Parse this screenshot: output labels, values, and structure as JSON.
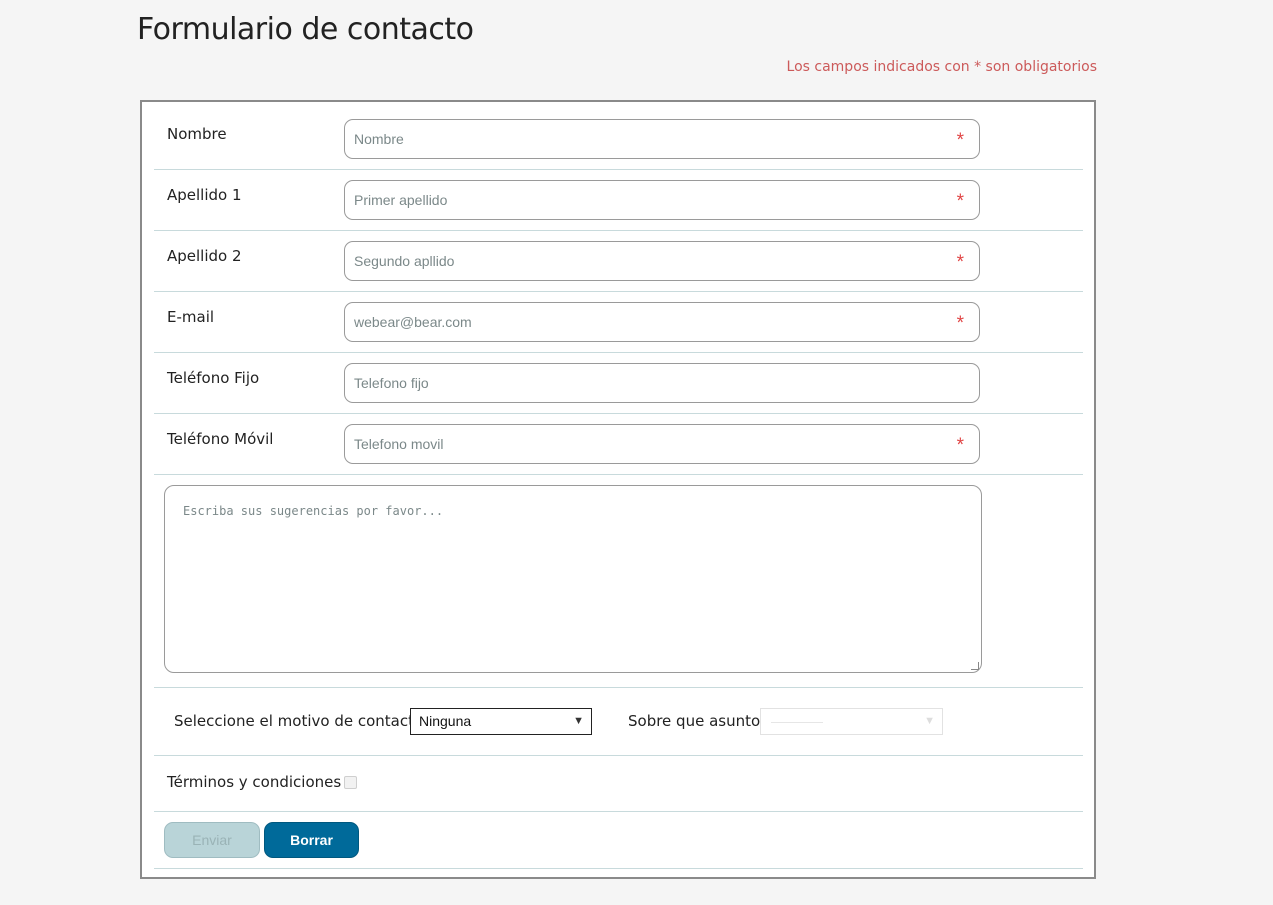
{
  "page": {
    "title": "Formulario de contacto",
    "required_note": "Los campos indicados con * son obligatorios"
  },
  "fields": [
    {
      "label": "Nombre",
      "placeholder": "Nombre",
      "required": true
    },
    {
      "label": "Apellido 1",
      "placeholder": "Primer apellido",
      "required": true
    },
    {
      "label": "Apellido 2",
      "placeholder": "Segundo apllido",
      "required": true
    },
    {
      "label": "E-mail",
      "placeholder": "webear@bear.com",
      "required": true
    },
    {
      "label": "Teléfono Fijo",
      "placeholder": "Telefono fijo",
      "required": false
    },
    {
      "label": "Teléfono Móvil",
      "placeholder": "Telefono movil",
      "required": true
    }
  ],
  "required_mark": "*",
  "suggestions": {
    "placeholder": "Escriba sus sugerencias por favor..."
  },
  "contact_reason": {
    "label": "Seleccione el motivo de contacto:",
    "selected": "Ninguna"
  },
  "subject": {
    "label": "Sobre que asunto:",
    "selected": "",
    "disabled": true
  },
  "terms": {
    "label": "Términos y condiciones",
    "checked": false
  },
  "buttons": {
    "send": "Enviar",
    "clear": "Borrar"
  },
  "colors": {
    "accent": "#006a9a",
    "required": "#e04545",
    "note": "#cc5a5a",
    "disabled_button": "#b9d4d8"
  }
}
